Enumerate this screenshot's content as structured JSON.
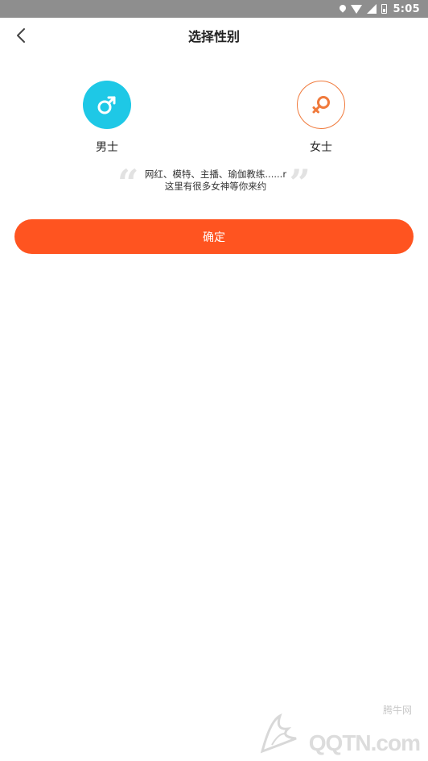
{
  "status_bar": {
    "time": "5:05"
  },
  "header": {
    "title": "选择性别"
  },
  "genders": {
    "male": {
      "label": "男士",
      "symbol": "♂",
      "color": "#1ec8e6"
    },
    "female": {
      "label": "女士",
      "symbol": "♀",
      "color": "#f07a3c"
    }
  },
  "quote": {
    "line1": "网红、模特、主播、瑜伽教练......r",
    "line2": "这里有很多女神等你来约"
  },
  "confirm": {
    "label": "确定",
    "color": "#ff5420"
  },
  "watermark": {
    "top": "腾牛网",
    "brand": "QQTN.com"
  }
}
